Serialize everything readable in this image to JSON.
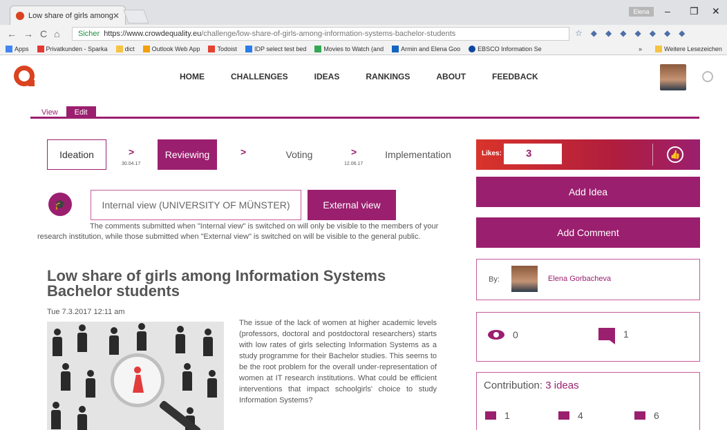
{
  "browser": {
    "tab_title": "Low share of girls among",
    "tab_close": "✕",
    "user_chip": "Elena",
    "url_secure_label": "Sicher",
    "url_host": "https://www.crowdequality.eu",
    "url_path": "/challenge/low-share-of-girls-among-information-systems-bachelor-students",
    "bookmarks": [
      "Apps",
      "Privatkunden - Sparka",
      "dict",
      "Outlook Web App",
      "Todoist",
      "IDP select test bed",
      "Movies to Watch (and",
      "Armin and Elena Goo",
      "EBSCO Information Se"
    ],
    "bookmarks_more": "»",
    "other_bookmarks": "Weitere Lesezeichen"
  },
  "nav": {
    "items": [
      "HOME",
      "CHALLENGES",
      "IDEAS",
      "RANKINGS",
      "ABOUT",
      "FEEDBACK"
    ]
  },
  "view_edit": {
    "view": "View",
    "edit": "Edit"
  },
  "steps": {
    "ideation": "Ideation",
    "reviewing": "Reviewing",
    "voting": "Voting",
    "implementation": "Implementation",
    "arrow": ">",
    "date1": "30.04.17",
    "date2": "12.06.17"
  },
  "visibility": {
    "internal": "Internal view (UNIVERSITY OF MÜNSTER)",
    "external": "External view",
    "notice": "The comments submitted when \"Internal view\" is switched on will only be visible to the members of your research institution, while those submitted when \"External view\" is switched on will be visible to the general public."
  },
  "challenge": {
    "title": "Low share of girls among Information Systems Bachelor students",
    "date": "Tue 7.3.2017 12:11 am",
    "description": "The issue of the lack of women at higher academic levels (professors, doctoral and postdoctoral researchers) starts with low rates of girls selecting Information Systems as a study programme for their Bachelor studies. This seems to be the root problem for the overall under-representation of women at IT research institutions. What could be efficient interventions that impact schoolgirls' choice to study Information Systems?"
  },
  "sidebar": {
    "likes_label": "Likes:",
    "likes_count": "3",
    "add_idea": "Add Idea",
    "add_comment": "Add Comment",
    "by_label": "By:",
    "author": "Elena Gorbacheva",
    "views": "0",
    "comments": "1",
    "contribution_label": "Contribution:",
    "contribution_value": "3 ideas",
    "contrib_people": "1",
    "contrib_likes": "4",
    "contrib_comments": "6"
  }
}
